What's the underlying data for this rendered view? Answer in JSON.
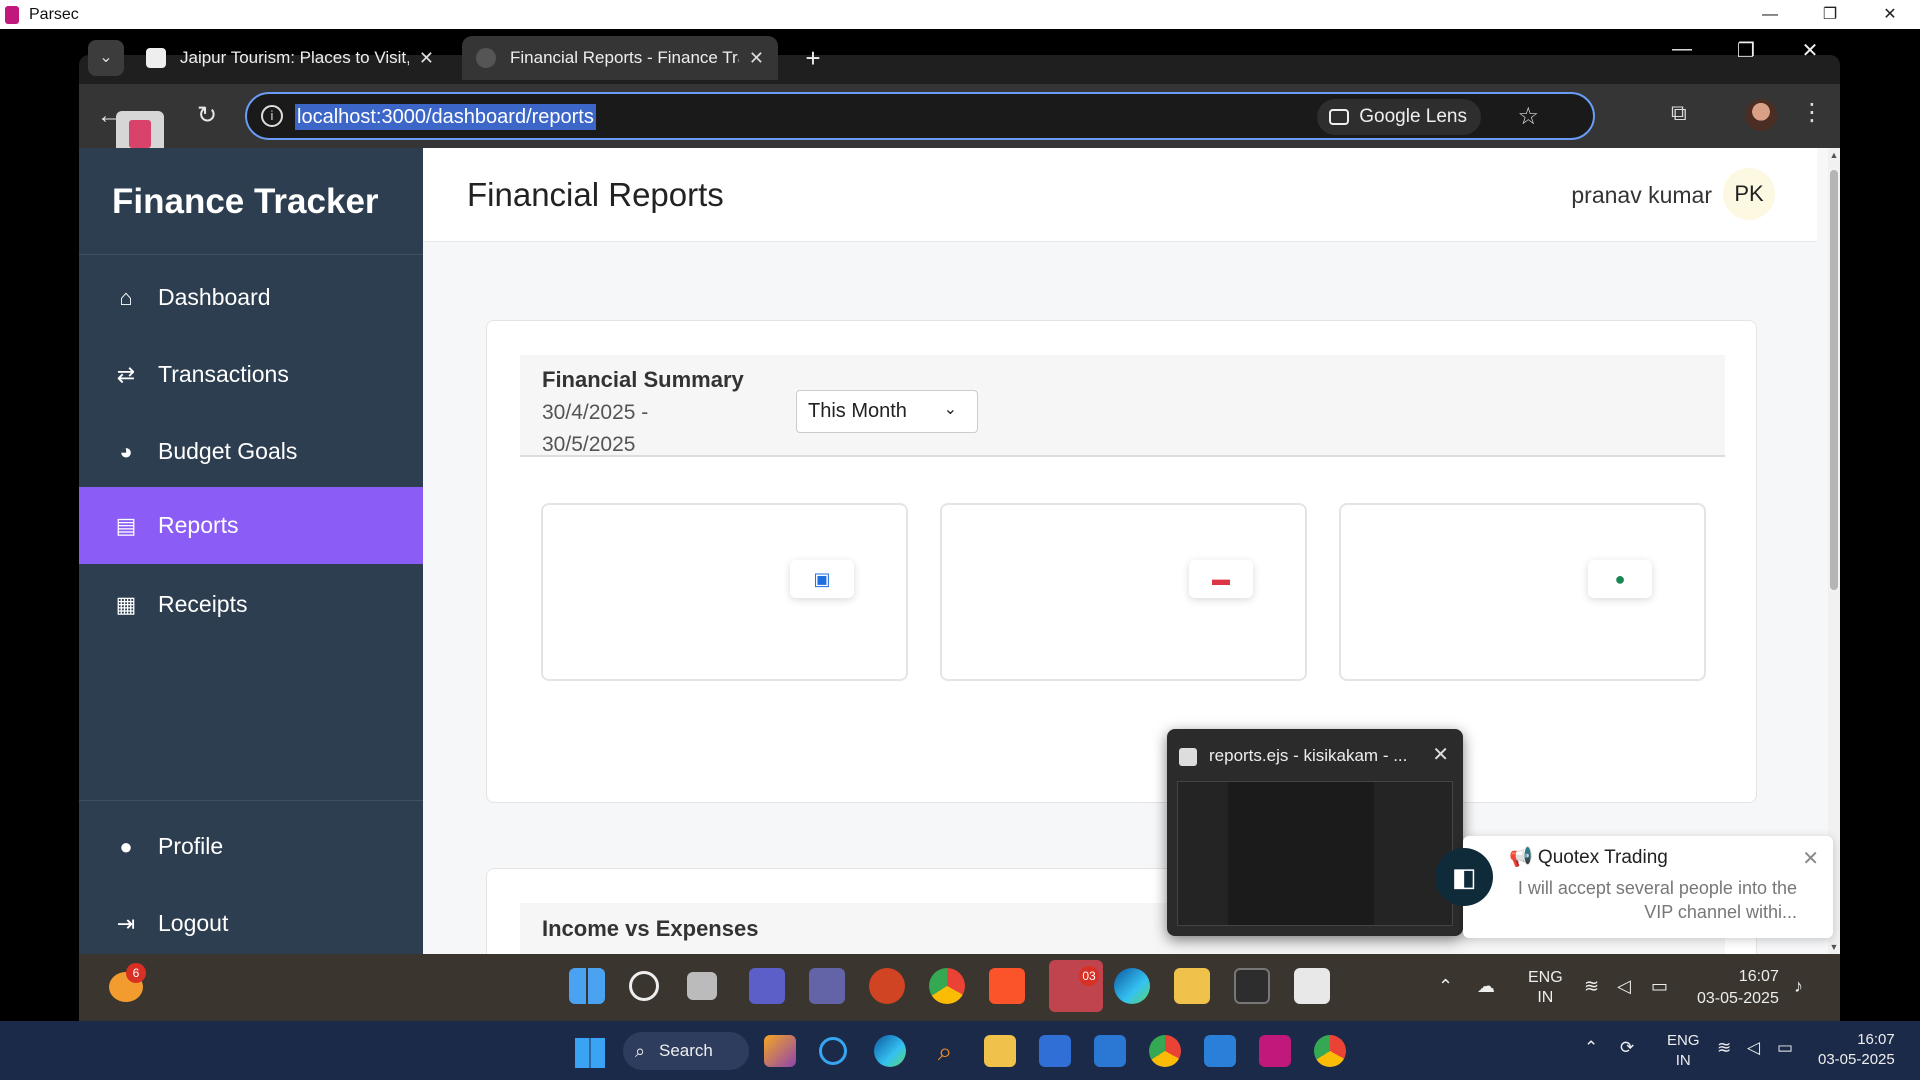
{
  "host": {
    "app_title": "Parsec",
    "controls": {
      "minimize": "—",
      "restore": "❐",
      "close": "✕"
    }
  },
  "browser": {
    "tabs": [
      {
        "title": "Jaipur Tourism: Places to Visit, S",
        "close": "✕"
      },
      {
        "title": "Financial Reports - Finance Trac",
        "close": "✕"
      }
    ],
    "new_tab": "+",
    "tab_overflow": "⌄",
    "window_controls": {
      "minimize": "—",
      "restore": "❐",
      "close": "✕"
    },
    "back": "←",
    "reload": "↻",
    "url": "localhost:3000/dashboard/reports",
    "site_info": "i",
    "lens_label": "Google Lens",
    "star": "☆",
    "extensions": "⧉",
    "menu": "⋮"
  },
  "sidebar": {
    "brand": "Finance Tracker",
    "items": [
      {
        "label": "Dashboard",
        "icon": "home-icon",
        "glyph": "⌂"
      },
      {
        "label": "Transactions",
        "icon": "exchange-icon",
        "glyph": "⇄"
      },
      {
        "label": "Budget Goals",
        "icon": "pie-chart-icon",
        "glyph": "◕"
      },
      {
        "label": "Reports",
        "icon": "bar-chart-icon",
        "glyph": "▤"
      },
      {
        "label": "Receipts",
        "icon": "receipt-icon",
        "glyph": "▦"
      }
    ],
    "bottom_items": [
      {
        "label": "Profile",
        "icon": "user-icon",
        "glyph": "●"
      },
      {
        "label": "Logout",
        "icon": "logout-icon",
        "glyph": "⇥"
      }
    ],
    "active_item": "Reports",
    "accent_color": "#8b5cf6"
  },
  "header": {
    "title": "Financial Reports",
    "user_name": "pranav kumar",
    "user_initials": "PK"
  },
  "summary": {
    "title": "Financial Summary",
    "date_range": "30/4/2025 - 30/5/2025",
    "period": "This Month",
    "period_chevron": "⌄",
    "stat_cards": [
      {
        "icon": "money-bill-icon",
        "glyph": "▣"
      },
      {
        "icon": "credit-card-icon",
        "glyph": "▬"
      },
      {
        "icon": "piggy-bank-icon",
        "glyph": "●"
      }
    ]
  },
  "income_vs_expenses": {
    "title": "Income vs Expenses"
  },
  "preview": {
    "title": "reports.ejs - kisikakam - ...",
    "close": "✕"
  },
  "toast": {
    "title": "📢 Quotex Trading",
    "body": "I will accept several people into the VIP channel withi...",
    "close": "✕",
    "badge": "◧"
  },
  "remote_taskbar": {
    "weather_badge": "6",
    "telegram_badge": "03",
    "lang_1": "ENG",
    "lang_2": "IN",
    "time": "16:07",
    "date": "03-05-2025"
  },
  "host_taskbar": {
    "search_label": "Search",
    "search_glyph": "⌕",
    "lang_1": "ENG",
    "lang_2": "IN",
    "time": "16:07",
    "date": "03-05-2025"
  }
}
